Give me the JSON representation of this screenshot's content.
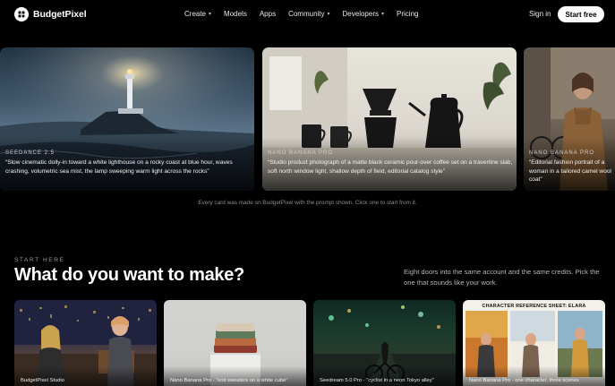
{
  "brand": {
    "name": "BudgetPixel"
  },
  "nav": {
    "items": [
      {
        "label": "Create",
        "dropdown": true
      },
      {
        "label": "Models",
        "dropdown": false
      },
      {
        "label": "Apps",
        "dropdown": false
      },
      {
        "label": "Community",
        "dropdown": true
      },
      {
        "label": "Developers",
        "dropdown": true
      },
      {
        "label": "Pricing",
        "dropdown": false
      }
    ],
    "signin": "Sign in",
    "cta": "Start free"
  },
  "showcase": {
    "cards": [
      {
        "model": "SEEDANCE 2.5",
        "prompt": "“Slow cinematic dolly-in toward a white lighthouse on a rocky coast at blue hour, waves crashing, volumetric sea mist, the lamp sweeping warm light across the rocks”"
      },
      {
        "model": "NANO BANANA PRO",
        "prompt": "“Studio product photograph of a matte black ceramic pour-over coffee set on a travertine slab, soft north window light, shallow depth of field, editorial catalog style”"
      },
      {
        "model": "NANO BANANA PRO",
        "prompt": "“Editorial fashion portrait of a woman in a tailored camel wool coat”"
      }
    ],
    "caption": "Every card was made on BudgetPixel with the prompt shown. Click one to start from it."
  },
  "section": {
    "eyebrow": "START HERE",
    "title": "What do you want to make?",
    "lede": "Eight doors into the same account and the same credits. Pick the one that sounds like your work."
  },
  "tiles": [
    {
      "label": "BudgetPixel Studio"
    },
    {
      "label": "Nano Banana Pro · \"knit sweaters on a white cube\""
    },
    {
      "label": "Seedream 5.0 Pro · \"cyclist in a neon Tokyo alley\""
    },
    {
      "label": "Nano Banana Pro · one character, three scenes",
      "sheet_title": "CHARACTER REFERENCE SHEET: ELARA"
    }
  ],
  "colors": {
    "background": "#000000",
    "cta_bg": "#ffffff",
    "cta_text": "#000000",
    "muted_text": "#8a8a8a"
  }
}
